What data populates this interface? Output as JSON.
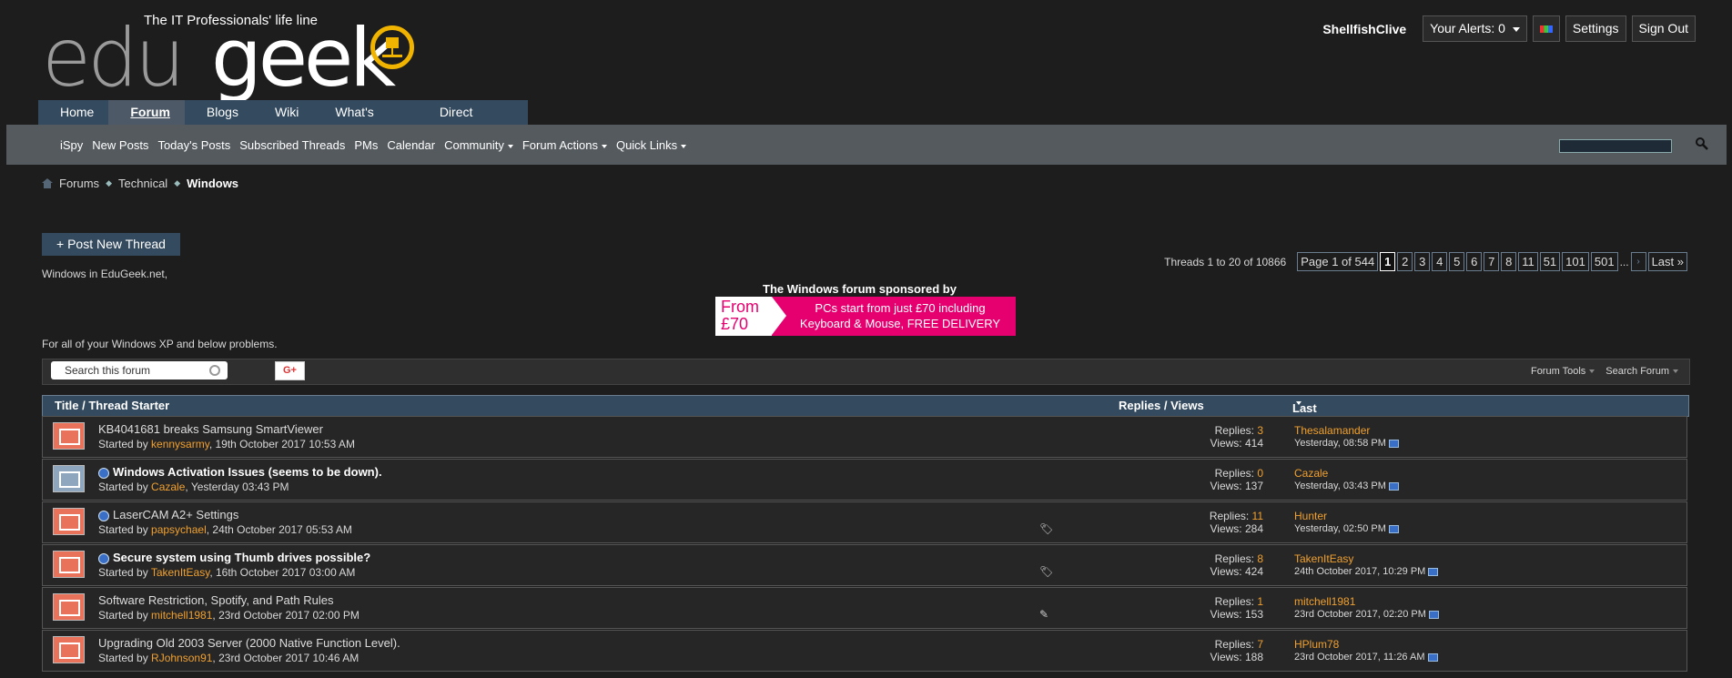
{
  "logo": {
    "tagline": "The IT Professionals' life line",
    "word1": "edu",
    "word2": "geek"
  },
  "user": {
    "name": "ShellfishClive",
    "alerts": "Your Alerts: 0",
    "settings": "Settings",
    "signout": "Sign Out"
  },
  "tabs": [
    "Home",
    "Forum",
    "Blogs",
    "Wiki",
    "What's New?",
    "Direct Support"
  ],
  "subnav": [
    "iSpy",
    "New Posts",
    "Today's Posts",
    "Subscribed Threads",
    "PMs",
    "Calendar",
    "Community",
    "Forum Actions",
    "Quick Links"
  ],
  "breadcrumb": [
    "Forums",
    "Technical",
    "Windows"
  ],
  "post_button": "+ Post New Thread",
  "forum_desc1": "Windows in EduGeek.net,",
  "forum_desc2": "For all of your Windows XP and below problems.",
  "sponsor": {
    "title": "The Windows forum sponsored by",
    "from1": "From",
    "from2": "£70",
    "line1": "PCs start from just £70 including",
    "line2": "Keyboard & Mouse, FREE DELIVERY"
  },
  "pagination": {
    "label": "Threads 1 to 20 of 10866",
    "page_of": "Page 1 of 544",
    "pages": [
      "1",
      "2",
      "3",
      "4",
      "5",
      "6",
      "7",
      "8",
      "11",
      "51",
      "101",
      "501"
    ],
    "ellipsis": "...",
    "next": "›",
    "last": "Last »"
  },
  "toolbar": {
    "search_placeholder": "Search this forum",
    "gplus": "G+",
    "forum_tools": "Forum Tools",
    "search_forum": "Search Forum"
  },
  "table": {
    "col_title": "Title / Thread Starter",
    "col_stats": "Replies / Views",
    "col_last": "Last Post By"
  },
  "threads": [
    {
      "title": "KB4041681 breaks Samsung SmartViewer",
      "starter": "kennysarmy",
      "date": ", 19th October 2017 10:53 AM",
      "replies": "3",
      "views": "414",
      "last_user": "Thesalamander",
      "last_time": "Yesterday, 08:58 PM"
    },
    {
      "title": "Windows Activation Issues (seems to be down).",
      "starter": "Cazale",
      "date": ", Yesterday 03:43 PM",
      "replies": "0",
      "views": "137",
      "last_user": "Cazale",
      "last_time": "Yesterday, 03:43 PM"
    },
    {
      "title": "LaserCAM A2+ Settings",
      "starter": "papsychael",
      "date": ", 24th October 2017 05:53 AM",
      "replies": "11",
      "views": "284",
      "last_user": "Hunter",
      "last_time": "Yesterday, 02:50 PM"
    },
    {
      "title": "Secure system using Thumb drives possible?",
      "starter": "TakenItEasy",
      "date": ", 16th October 2017 03:00 AM",
      "replies": "8",
      "views": "424",
      "last_user": "TakenItEasy",
      "last_time": "24th October 2017, 10:29 PM"
    },
    {
      "title": "Software Restriction, Spotify, and Path Rules",
      "starter": "mitchell1981",
      "date": ", 23rd October 2017 02:00 PM",
      "replies": "1",
      "views": "153",
      "last_user": "mitchell1981",
      "last_time": "23rd October 2017, 02:20 PM"
    },
    {
      "title": "Upgrading Old 2003 Server (2000 Native Function Level).",
      "starter": "RJohnson91",
      "date": ", 23rd October 2017 10:46 AM",
      "replies": "7",
      "views": "188",
      "last_user": "HPlum78",
      "last_time": "23rd October 2017, 11:26 AM"
    }
  ],
  "labels": {
    "started_by": "Started by ",
    "replies": "Replies: ",
    "views": "Views: "
  }
}
